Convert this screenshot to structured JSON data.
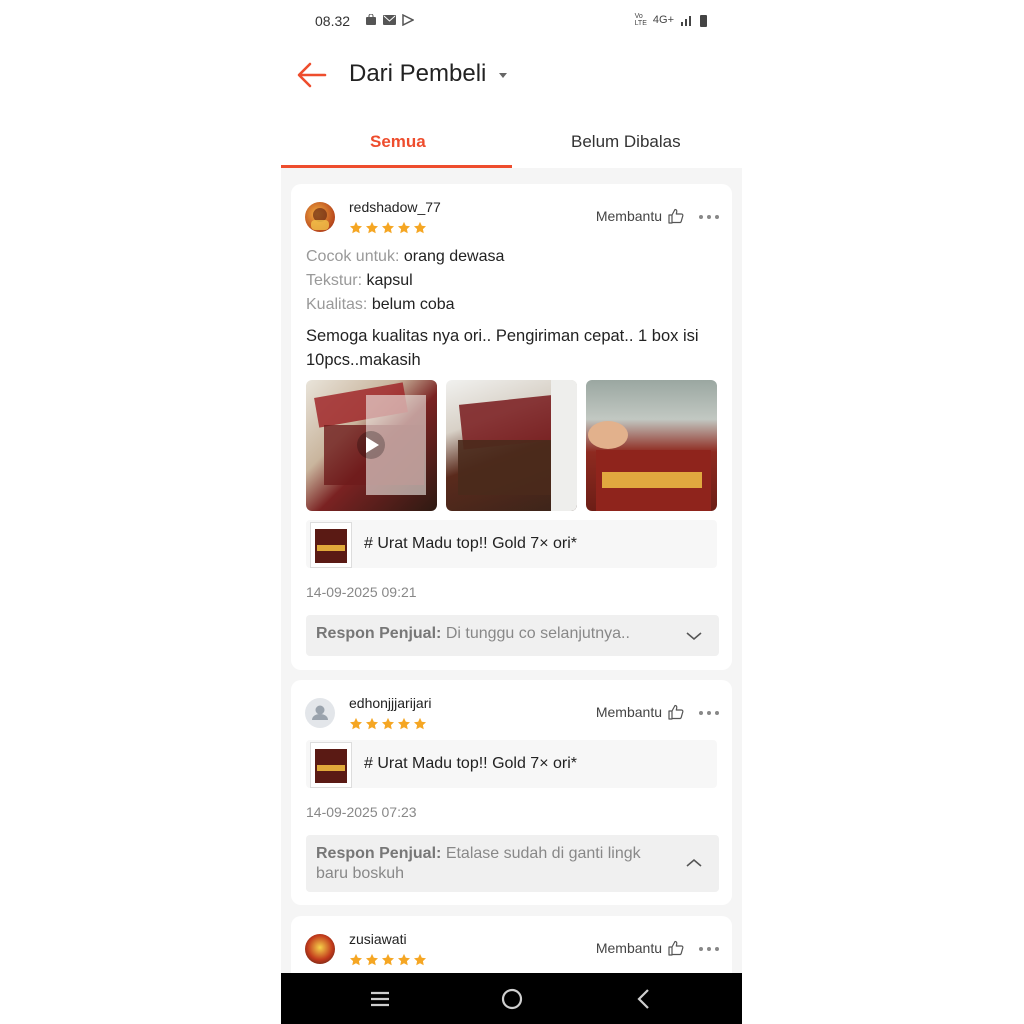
{
  "status_bar": {
    "time": "08.32",
    "network": "4G+"
  },
  "header": {
    "title": "Dari Pembeli"
  },
  "tabs": {
    "all": "Semua",
    "unreplied": "Belum Dibalas"
  },
  "reviews": [
    {
      "username": "redshadow_77",
      "rating": 5,
      "helpful": "Membantu",
      "attributes": [
        {
          "key": "Cocok untuk:",
          "value": "orang dewasa"
        },
        {
          "key": "Tekstur:",
          "value": "kapsul"
        },
        {
          "key": "Kualitas:",
          "value": "belum coba"
        }
      ],
      "comment": "Semoga kualitas nya ori.. Pengiriman cepat.. 1 box isi 10pcs..makasih",
      "media": [
        "video",
        "photo",
        "photo"
      ],
      "product": "# Urat Madu  top!! Gold 7× ori*",
      "date": "14-09-2025 09:21",
      "seller_response_label": "Respon Penjual:",
      "seller_response": "Di tunggu co selanjutnya..",
      "response_expanded": false
    },
    {
      "username": "edhonjjjarijari",
      "rating": 5,
      "helpful": "Membantu",
      "product": "# Urat Madu  top!! Gold 7× ori*",
      "date": "14-09-2025 07:23",
      "seller_response_label": "Respon Penjual:",
      "seller_response": "Etalase sudah di ganti lingk baru boskuh",
      "response_expanded": true
    },
    {
      "username": "zusiawati",
      "rating": 5,
      "helpful": "Membantu"
    }
  ],
  "colors": {
    "accent": "#ee4d2d",
    "star": "#f5a623"
  }
}
